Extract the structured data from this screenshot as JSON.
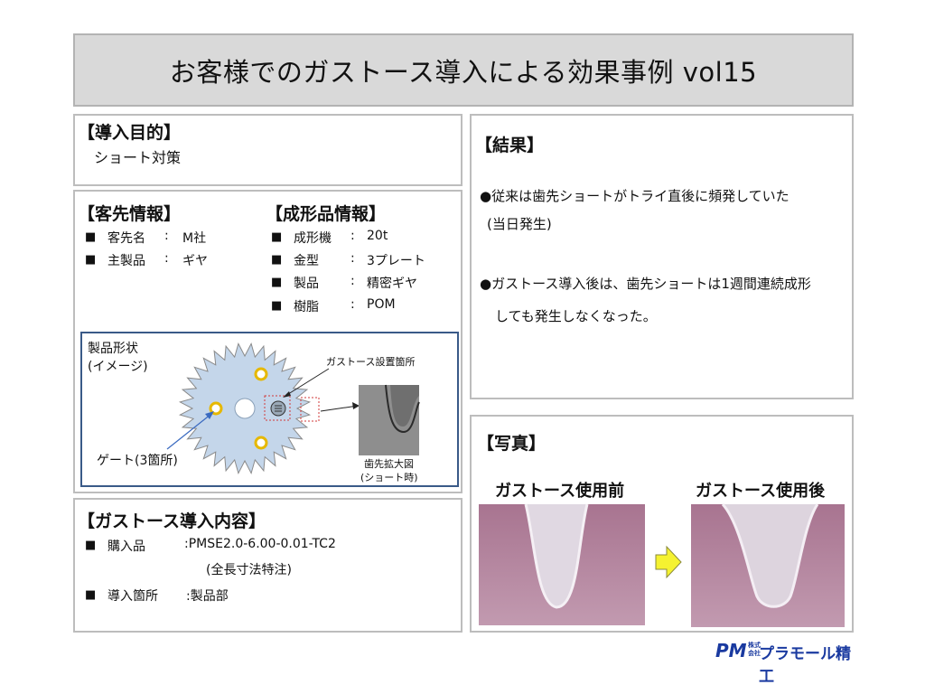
{
  "title": "お客様でのガストース導入による効果事例 vol15",
  "purpose": {
    "heading": "【導入目的】",
    "text": "ショート対策"
  },
  "customer": {
    "heading": "【客先情報】",
    "rows": [
      {
        "bullet": "■",
        "label": "客先名",
        "sep": ":",
        "value": "M社"
      },
      {
        "bullet": "■",
        "label": "主製品",
        "sep": ":",
        "value": "ギヤ"
      }
    ]
  },
  "molded": {
    "heading": "【成形品情報】",
    "rows": [
      {
        "bullet": "■",
        "label": "成形機",
        "sep": ":",
        "value": "20t"
      },
      {
        "bullet": "■",
        "label": "金型",
        "sep": ":",
        "value": "3プレート"
      },
      {
        "bullet": "■",
        "label": "製品",
        "sep": ":",
        "value": "精密ギヤ"
      },
      {
        "bullet": "■",
        "label": "樹脂",
        "sep": ":",
        "value": "POM"
      }
    ]
  },
  "shape": {
    "label1": "製品形状",
    "label2": "(イメージ)",
    "install_label": "ガストース設置箇所",
    "gate_label": "ゲート(3箇所)",
    "zoom_label1": "歯先拡大図",
    "zoom_label2": "(ショート時)"
  },
  "intro": {
    "heading": "【ガストース導入内容】",
    "purchase_label": "購入品",
    "purchase_value": ":PMSE2.0-6.00-0.01-TC2",
    "purchase_note": "(全長寸法特注)",
    "place_label": "導入箇所",
    "place_value": ":製品部",
    "bullet": "■"
  },
  "result": {
    "heading": "【結果】",
    "line1": "●従来は歯先ショートがトライ直後に頻発していた",
    "line2": "(当日発生)",
    "line3": "●ガストース導入後は、歯先ショートは1週間連続成形",
    "line4": "しても発生しなくなった。"
  },
  "photo": {
    "heading": "【写真】",
    "before_label": "ガストース使用前",
    "after_label": "ガストース使用後"
  },
  "logo": {
    "mark": "PM",
    "small1": "株式",
    "small2": "会社",
    "name": "プラモール精工"
  },
  "colors": {
    "gear_fill": "#c4d6ea",
    "gate_ring": "#e6b800",
    "arrow_fill": "#f5f230",
    "photo_bg": "#b27d99",
    "logo_blue": "#1a3aa0"
  }
}
